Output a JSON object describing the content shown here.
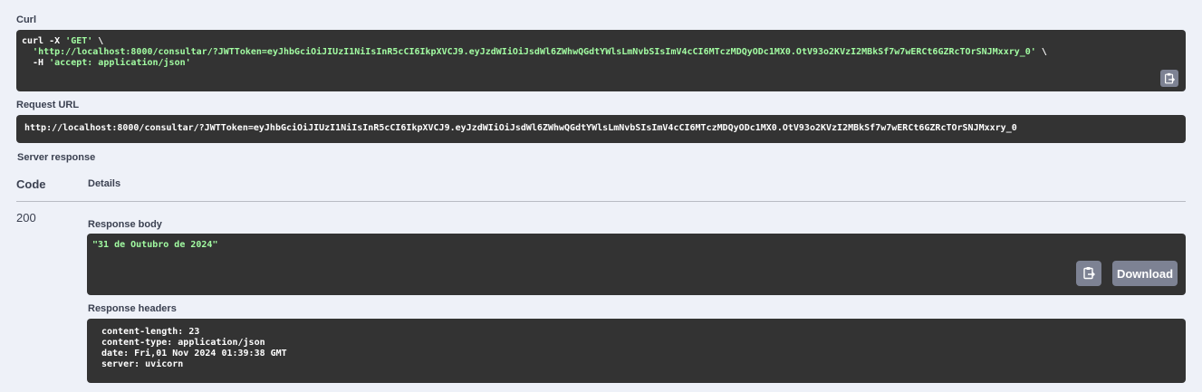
{
  "curl": {
    "label": "Curl",
    "line1_cmd": "curl -X ",
    "line1_method": "'GET'",
    "line1_end": " \\",
    "line2_indent": "  ",
    "line2_url": "'http://localhost:8000/consultar/?JWTToken=eyJhbGciOiJIUzI1NiIsInR5cCI6IkpXVCJ9.eyJzdWIiOiJsdWl6ZWhwQGdtYWlsLmNvbSIsImV4cCI6MTczMDQyODc1MX0.OtV93o2KVzI2MBkSf7w7wERCt6GZRcTOrSNJMxxry_0'",
    "line2_end": " \\",
    "line3_flag": "  -H ",
    "line3_header": "'accept: application/json'"
  },
  "request_url": {
    "label": "Request URL",
    "value": "http://localhost:8000/consultar/?JWTToken=eyJhbGciOiJIUzI1NiIsInR5cCI6IkpXVCJ9.eyJzdWIiOiJsdWl6ZWhwQGdtYWlsLmNvbSIsImV4cCI6MTczMDQyODc1MX0.OtV93o2KVzI2MBkSf7w7wERCt6GZRcTOrSNJMxxry_0"
  },
  "server_response": {
    "label": "Server response",
    "col_code": "Code",
    "col_details": "Details",
    "code": "200",
    "body_label": "Response body",
    "body_value": "\"31 de Outubro de 2024\"",
    "download_label": "Download",
    "headers_label": "Response headers",
    "headers": [
      "content-length: 23",
      "content-type: application/json",
      "date: Fri,01 Nov 2024 01:39:38 GMT",
      "server: uvicorn"
    ]
  },
  "icons": {
    "copy": "clipboard-icon"
  },
  "colors": {
    "background": "#eef1f8",
    "code_bg": "#333333",
    "string_token": "#a2fca2",
    "button_bg": "#7d8293"
  }
}
